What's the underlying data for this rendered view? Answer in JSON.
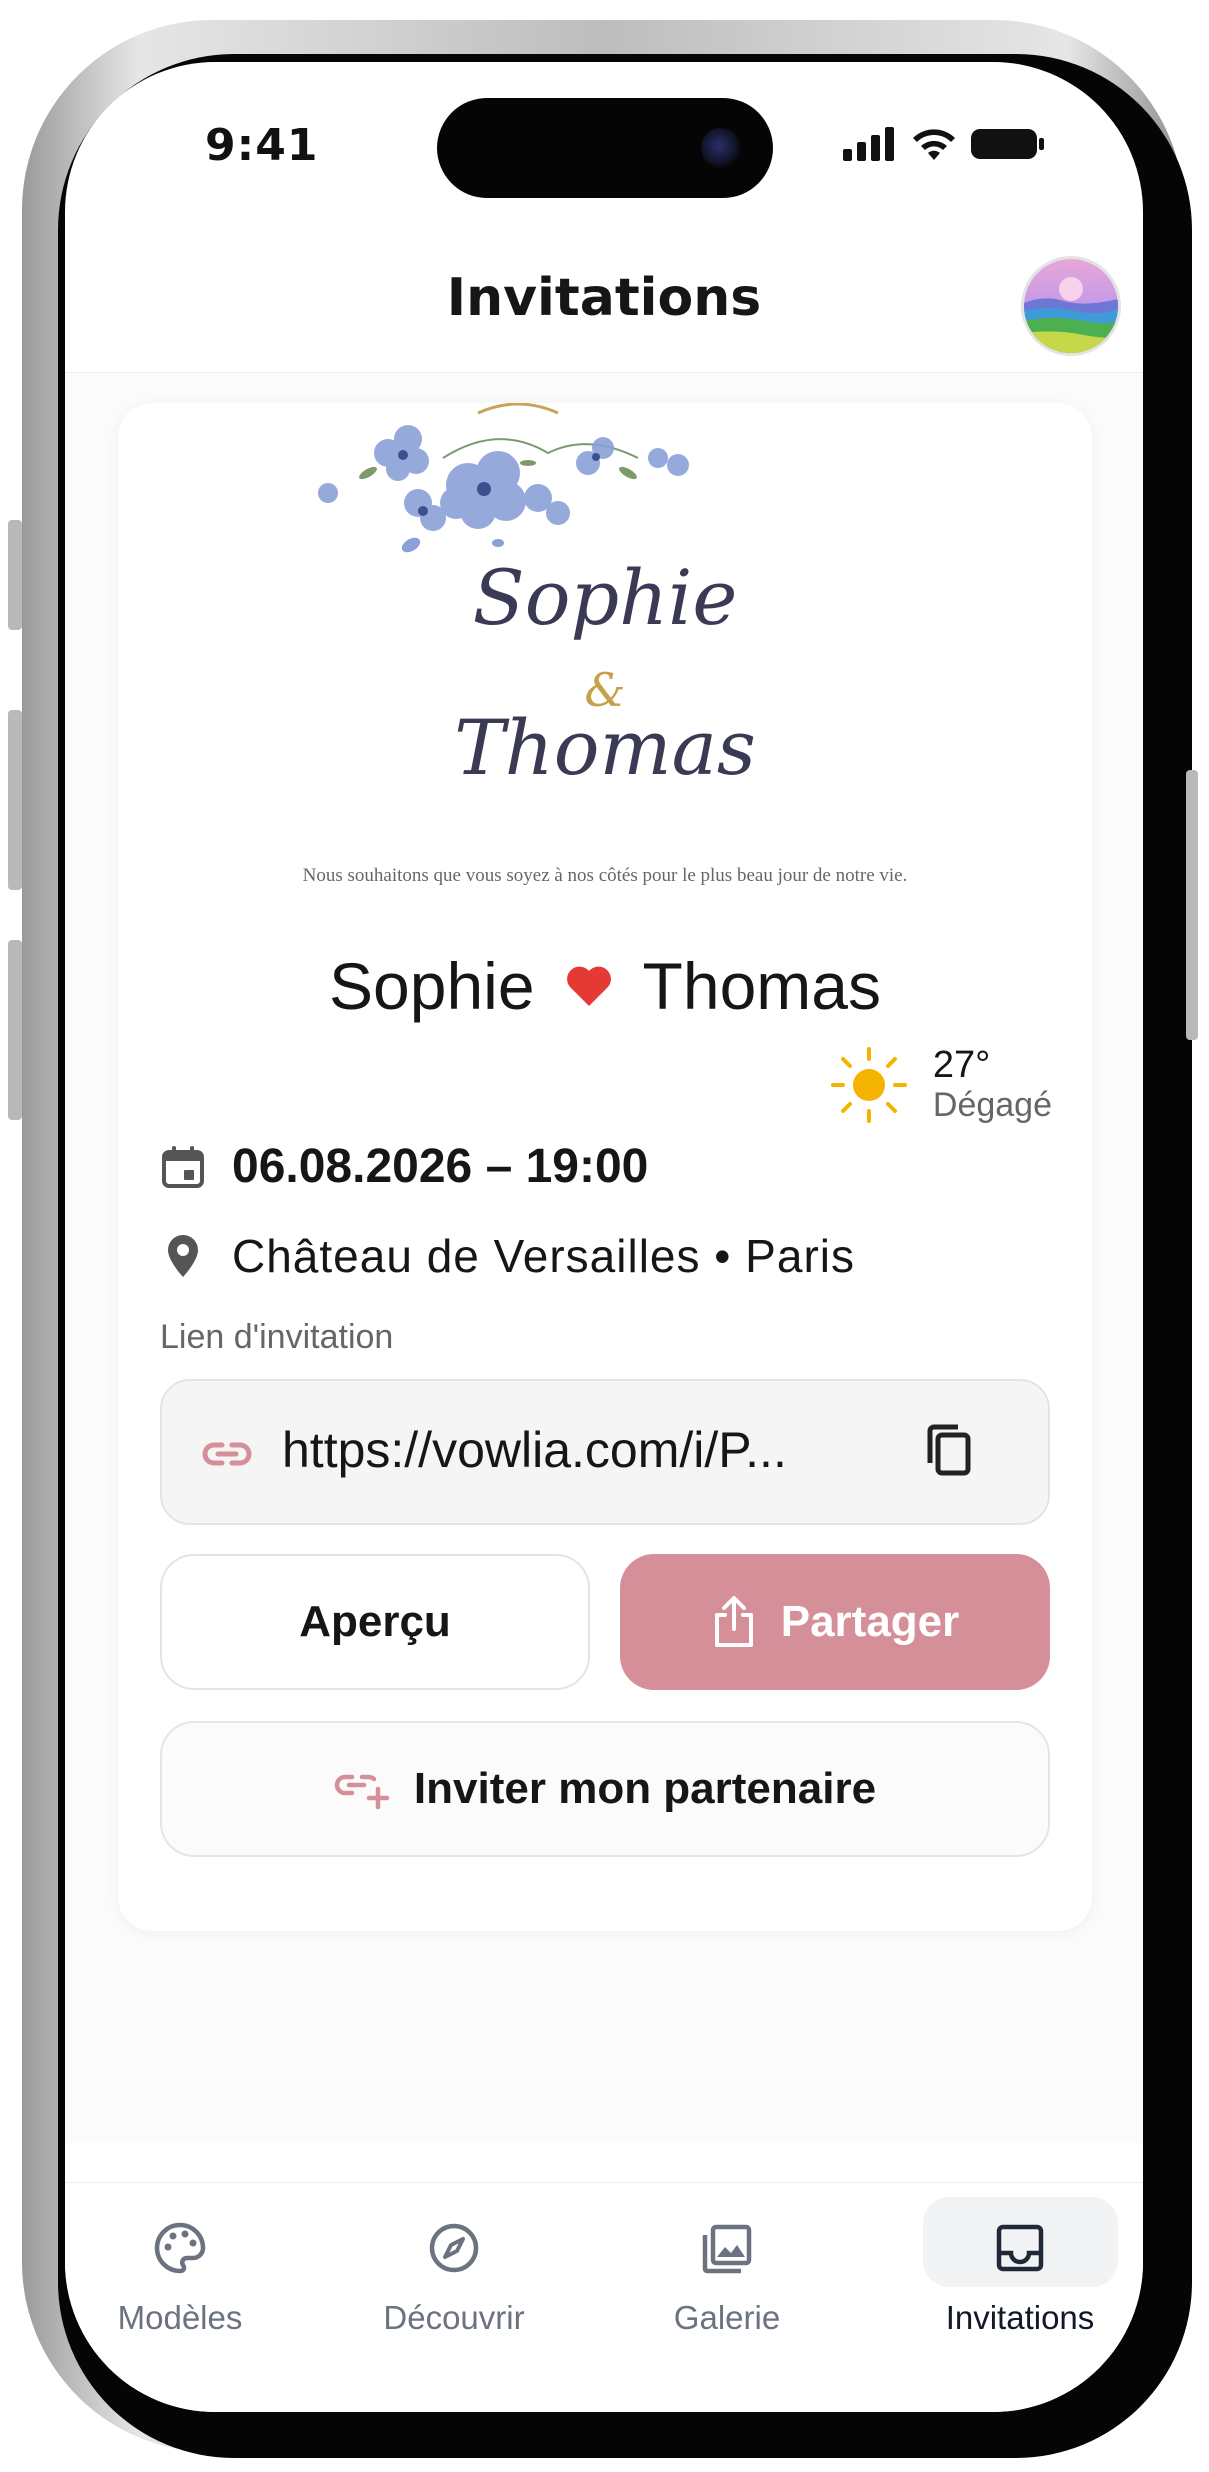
{
  "status_bar": {
    "time": "9:41"
  },
  "header": {
    "title": "Invitations"
  },
  "invitation": {
    "art": {
      "name1": "Sophie",
      "ampersand": "&",
      "name2": "Thomas",
      "tagline": "Nous souhaitons que vous soyez à nos côtés pour le plus beau jour de notre vie."
    },
    "couple": {
      "name1": "Sophie",
      "name2": "Thomas"
    },
    "weather": {
      "temperature": "27°",
      "condition": "Dégagé"
    },
    "date_time": "06.08.2026 – 19:00",
    "location": "Château de Versailles • Paris",
    "link_label": "Lien d'invitation",
    "link_url": "https://vowlia.com/i/P...",
    "buttons": {
      "preview": "Aperçu",
      "share": "Partager",
      "invite_partner": "Inviter mon partenaire"
    }
  },
  "tabs": [
    {
      "label": "Modèles",
      "icon": "palette-icon",
      "active": false
    },
    {
      "label": "Découvrir",
      "icon": "compass-icon",
      "active": false
    },
    {
      "label": "Galerie",
      "icon": "gallery-icon",
      "active": false
    },
    {
      "label": "Invitations",
      "icon": "inbox-icon",
      "active": true
    }
  ],
  "colors": {
    "accent": "#d48f98",
    "heart": "#e53935",
    "sun": "#f5b301",
    "flowers": "#7f95cf"
  }
}
